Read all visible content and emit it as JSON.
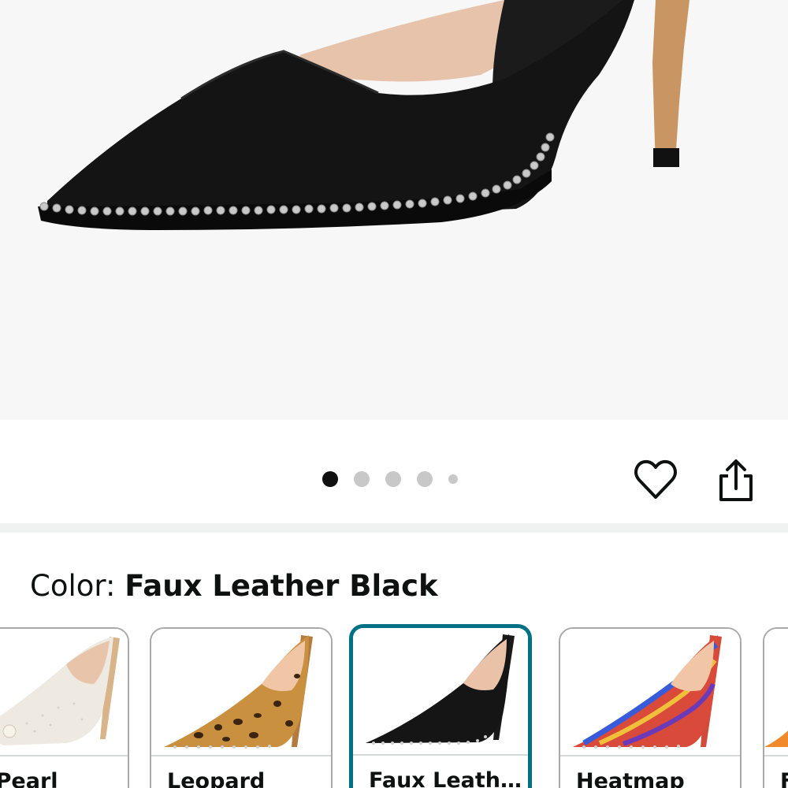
{
  "hero": {
    "image_icon": "black-pump-shoe-closeup",
    "dots": {
      "count": 5,
      "active_index": 0
    }
  },
  "actions": {
    "favorite_icon": "heart-icon",
    "share_icon": "share-icon"
  },
  "color": {
    "label": "Color: ",
    "selected": "Faux Leather Black"
  },
  "swatches": [
    {
      "label": "te Pearl",
      "image_icon": "white-pearl-pump"
    },
    {
      "label": "Leopard",
      "image_icon": "leopard-pump"
    },
    {
      "label": "Faux Leather ...",
      "image_icon": "black-pump",
      "selected": true
    },
    {
      "label": "Heatmap",
      "image_icon": "heatmap-pump"
    },
    {
      "label": "F",
      "image_icon": "orange-pump"
    }
  ],
  "colors": {
    "selected_border": "#007185",
    "text": "#0f1111",
    "hero_bg": "#f7f7f7"
  }
}
